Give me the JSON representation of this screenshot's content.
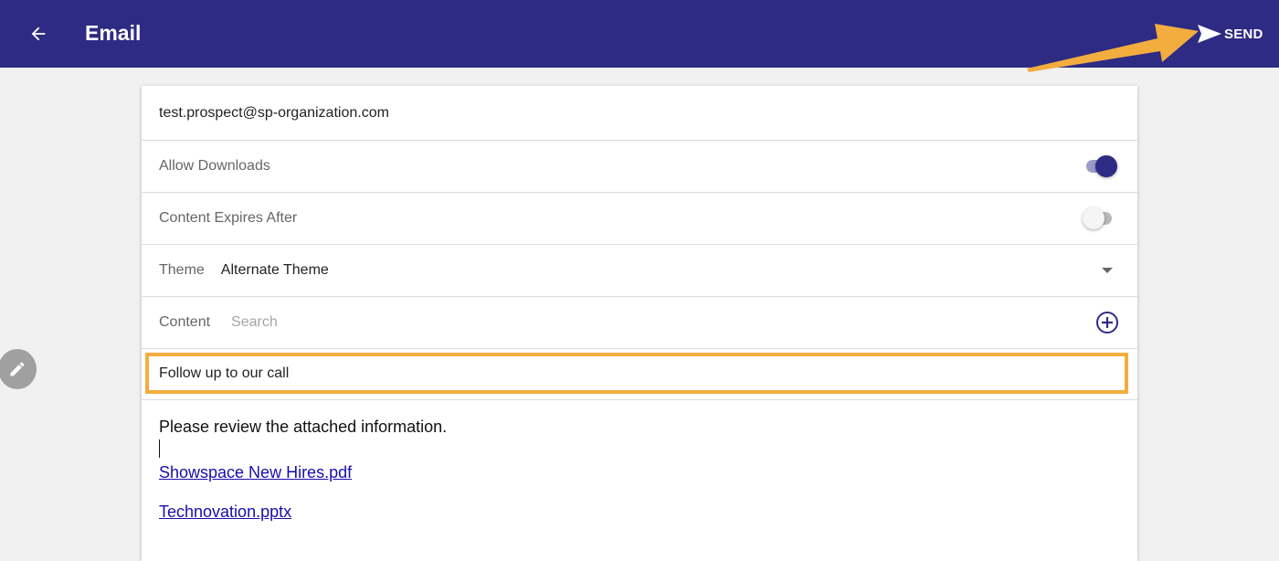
{
  "header": {
    "title": "Email",
    "send_label": "SEND",
    "back_icon": "arrow-left-icon",
    "send_icon": "paper-plane-icon",
    "background_color": "#2e2b84"
  },
  "form": {
    "recipient": "test.prospect@sp-organization.com",
    "allow_downloads": {
      "label": "Allow Downloads",
      "enabled": true
    },
    "content_expires": {
      "label": "Content Expires After",
      "enabled": false
    },
    "theme": {
      "label": "Theme",
      "value": "Alternate Theme"
    },
    "content": {
      "label": "Content",
      "placeholder": "Search"
    },
    "subject": "Follow up to our call",
    "body": {
      "text": "Please review the attached information.",
      "attachments": [
        "Showspace New Hires.pdf",
        "Technovation.pptx"
      ]
    }
  },
  "colors": {
    "accent": "#2e2b84",
    "highlight": "#f3ad3e",
    "link": "#1a0dab"
  }
}
